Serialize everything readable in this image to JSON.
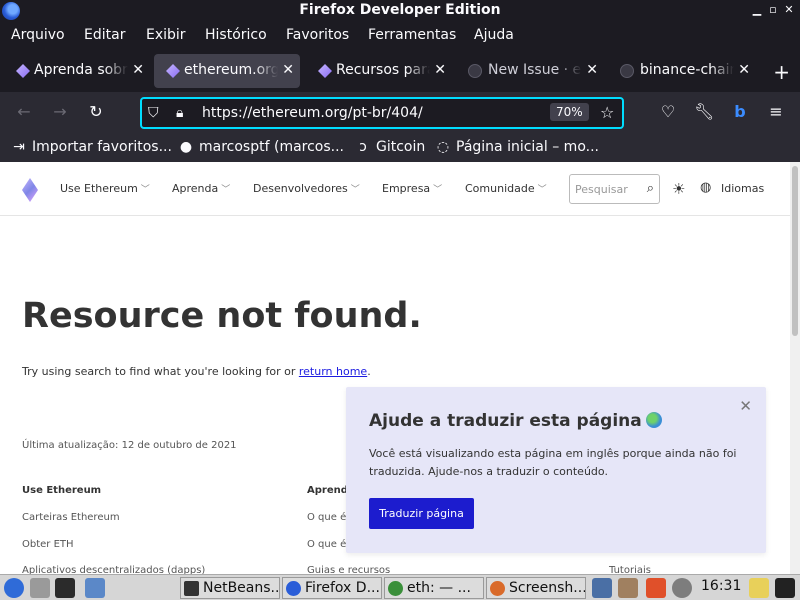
{
  "window": {
    "title": "Firefox Developer Edition",
    "controls": {
      "minimize": "▁",
      "maximize": "▫",
      "close": "✕"
    }
  },
  "menu": [
    "Arquivo",
    "Editar",
    "Exibir",
    "Histórico",
    "Favoritos",
    "Ferramentas",
    "Ajuda"
  ],
  "tabs": [
    {
      "label": "Aprenda sobre",
      "icon": "ethereum-icon",
      "active": false
    },
    {
      "label": "ethereum.org/",
      "icon": "ethereum-icon",
      "active": true
    },
    {
      "label": "Recursos para",
      "icon": "ethereum-icon",
      "active": false
    },
    {
      "label": "New Issue · et",
      "icon": "github-icon",
      "active": false
    },
    {
      "label": "binance-chain",
      "icon": "github-icon",
      "active": false
    }
  ],
  "new_tab_label": "+",
  "urlbar": {
    "url": "https://ethereum.org/pt-br/404/",
    "zoom": "70%"
  },
  "bookmarks": [
    {
      "label": "Importar favoritos...",
      "icon": "import-icon"
    },
    {
      "label": "marcosptf (marcos...",
      "icon": "github-icon"
    },
    {
      "label": "Gitcoin",
      "icon": "gitcoin-icon"
    },
    {
      "label": "Página inicial – mo...",
      "icon": "globe-icon"
    }
  ],
  "site": {
    "nav": [
      "Use Ethereum",
      "Aprenda",
      "Desenvolvedores",
      "Empresa",
      "Comunidade"
    ],
    "search_placeholder": "Pesquisar",
    "languages_label": "Idiomas",
    "heading": "Resource not found.",
    "try_text": "Try using search to find what you're looking for or ",
    "return_home": "return home",
    "try_end": ".",
    "last_updated": "Última atualização: 12 de outubro de 2021",
    "footer": {
      "col1_title": "Use Ethereum",
      "col1_links": [
        "Carteiras Ethereum",
        "Obter ETH",
        "Aplicativos descentralizados (dapps)"
      ],
      "col2_title": "Aprend",
      "col2_links": [
        "O que é",
        "O que é",
        "Guias e recursos"
      ],
      "col3_links": [
        "Tutoriais"
      ]
    },
    "translate_popup": {
      "title": "Ajude a traduzir esta página",
      "body": "Você está visualizando esta página em inglês porque ainda não foi traduzida. Ajude-nos a traduzir o conteúdo.",
      "button": "Traduzir página",
      "close": "✕"
    }
  },
  "taskbar": {
    "buttons": [
      {
        "label": "NetBeans..."
      },
      {
        "label": "Firefox D..."
      },
      {
        "label": "eth:  — ..."
      },
      {
        "label": "Screensh..."
      }
    ],
    "clock": "16:31"
  }
}
